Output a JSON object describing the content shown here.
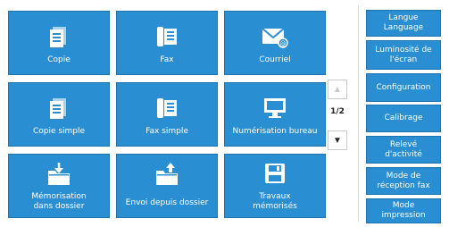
{
  "tiles": [
    {
      "id": "copie",
      "label": "Copie",
      "icon": "copy-icon"
    },
    {
      "id": "fax",
      "label": "Fax",
      "icon": "fax-icon"
    },
    {
      "id": "courriel",
      "label": "Courriel",
      "icon": "email-icon"
    },
    {
      "id": "copie-simple",
      "label": "Copie simple",
      "icon": "copy-icon"
    },
    {
      "id": "fax-simple",
      "label": "Fax simple",
      "icon": "fax-icon"
    },
    {
      "id": "numerisation-bureau",
      "label": "Numérisation bureau",
      "icon": "monitor-icon"
    },
    {
      "id": "memorisation-dossier",
      "label": "Mémorisation\ndans dossier",
      "icon": "folder-download-icon"
    },
    {
      "id": "envoi-dossier",
      "label": "Envoi depuis dossier",
      "icon": "folder-upload-icon"
    },
    {
      "id": "travaux-memorises",
      "label": "Travaux\nmémorisés",
      "icon": "floppy-disk-icon"
    }
  ],
  "pager": {
    "up_glyph": "▲",
    "down_glyph": "▼",
    "indicator": "1/2"
  },
  "sidebar": [
    {
      "id": "langue",
      "label": "Langue\nLanguage"
    },
    {
      "id": "luminosite",
      "label": "Luminosité de\nl'écran"
    },
    {
      "id": "configuration",
      "label": "Configuration"
    },
    {
      "id": "calibrage",
      "label": "Calibrage"
    },
    {
      "id": "releve",
      "label": "Relevé\nd'activité"
    },
    {
      "id": "mode-reception-fax",
      "label": "Mode de\nréception fax"
    },
    {
      "id": "mode-impression",
      "label": "Mode\nimpression"
    }
  ],
  "colors": {
    "tile": "#2a8ed2",
    "tile_border": "#1c73b0",
    "text_on_tile": "#ffffff"
  }
}
